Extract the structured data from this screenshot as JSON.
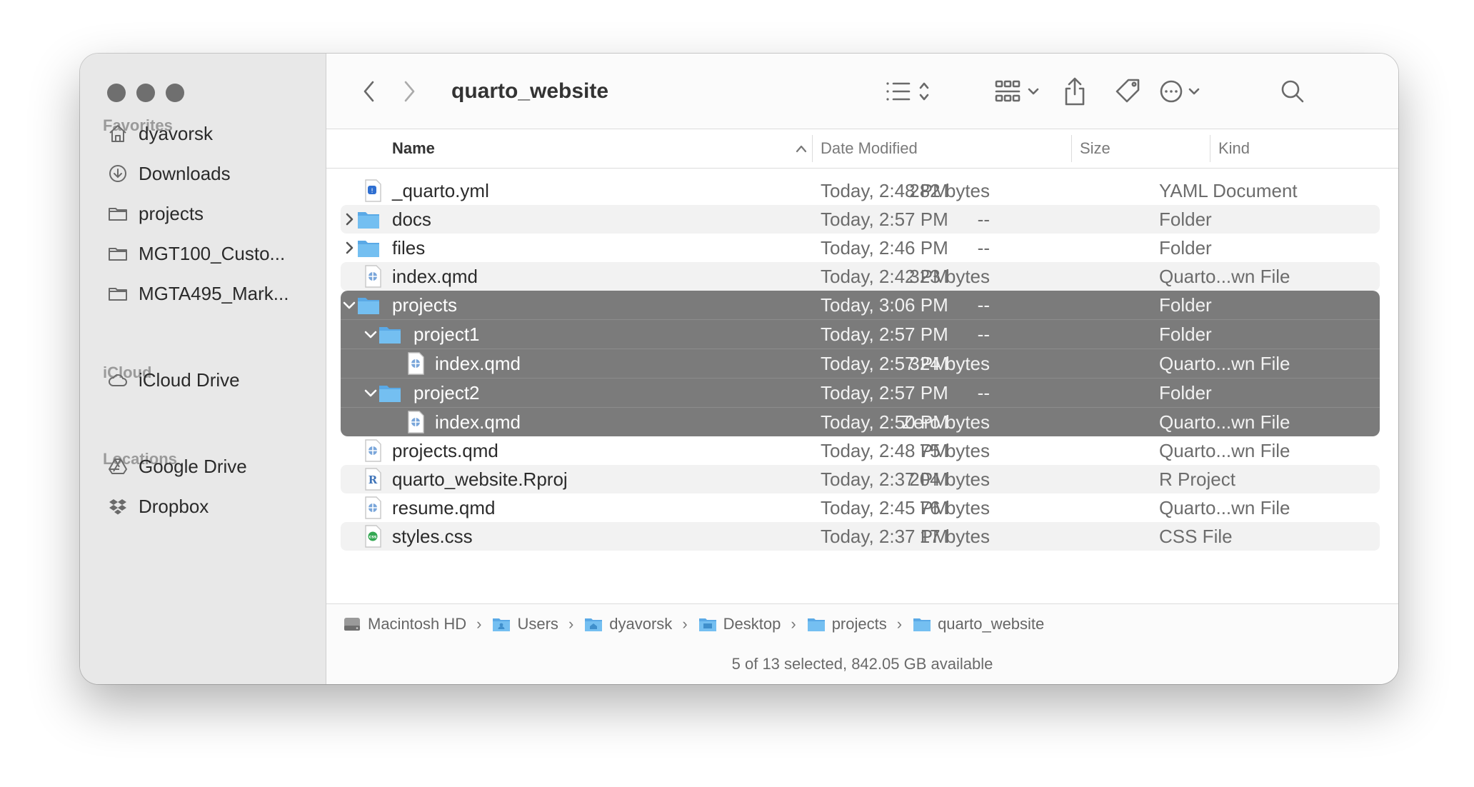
{
  "window": {
    "title": "quarto_website"
  },
  "sidebar": {
    "favorites_label": "Favorites",
    "favorites": [
      {
        "label": "dyavorsk",
        "icon": "home-icon"
      },
      {
        "label": "Downloads",
        "icon": "download-icon"
      },
      {
        "label": "projects",
        "icon": "folder-icon"
      },
      {
        "label": "MGT100_Custo...",
        "icon": "folder-icon"
      },
      {
        "label": "MGTA495_Mark...",
        "icon": "folder-icon"
      }
    ],
    "icloud_label": "iCloud",
    "icloud": [
      {
        "label": "iCloud Drive",
        "icon": "cloud-icon"
      }
    ],
    "locations_label": "Locations",
    "locations": [
      {
        "label": "Google Drive",
        "icon": "google-drive-icon"
      },
      {
        "label": "Dropbox",
        "icon": "dropbox-icon"
      }
    ]
  },
  "table": {
    "columns": {
      "name": "Name",
      "date": "Date Modified",
      "size": "Size",
      "kind": "Kind"
    },
    "rows": [
      {
        "name": "_quarto.yml",
        "date": "Today, 2:48 PM",
        "size": "282 bytes",
        "kind": "YAML Document",
        "icon": "yaml-file-icon"
      },
      {
        "name": "docs",
        "date": "Today, 2:57 PM",
        "size": "--",
        "kind": "Folder",
        "icon": "folder-icon"
      },
      {
        "name": "files",
        "date": "Today, 2:46 PM",
        "size": "--",
        "kind": "Folder",
        "icon": "folder-icon"
      },
      {
        "name": "index.qmd",
        "date": "Today, 2:42 PM",
        "size": "323 bytes",
        "kind": "Quarto...wn File",
        "icon": "quarto-file-icon"
      },
      {
        "name": "projects",
        "date": "Today, 3:06 PM",
        "size": "--",
        "kind": "Folder",
        "icon": "folder-icon"
      },
      {
        "name": "project1",
        "date": "Today, 2:57 PM",
        "size": "--",
        "kind": "Folder",
        "icon": "folder-icon"
      },
      {
        "name": "index.qmd",
        "date": "Today, 2:57 PM",
        "size": "324 bytes",
        "kind": "Quarto...wn File",
        "icon": "quarto-file-icon"
      },
      {
        "name": "project2",
        "date": "Today, 2:57 PM",
        "size": "--",
        "kind": "Folder",
        "icon": "folder-icon"
      },
      {
        "name": "index.qmd",
        "date": "Today, 2:50 PM",
        "size": "Zero bytes",
        "kind": "Quarto...wn File",
        "icon": "quarto-file-icon"
      },
      {
        "name": "projects.qmd",
        "date": "Today, 2:48 PM",
        "size": "75 bytes",
        "kind": "Quarto...wn File",
        "icon": "quarto-file-icon"
      },
      {
        "name": "quarto_website.Rproj",
        "date": "Today, 2:37 PM",
        "size": "204 bytes",
        "kind": "R Project",
        "icon": "r-project-icon"
      },
      {
        "name": "resume.qmd",
        "date": "Today, 2:45 PM",
        "size": "76 bytes",
        "kind": "Quarto...wn File",
        "icon": "quarto-file-icon"
      },
      {
        "name": "styles.css",
        "date": "Today, 2:37 PM",
        "size": "17 bytes",
        "kind": "CSS File",
        "icon": "css-file-icon"
      }
    ]
  },
  "pathbar": [
    {
      "label": "Macintosh HD",
      "icon": "hard-drive-icon"
    },
    {
      "label": "Users",
      "icon": "folder-icon"
    },
    {
      "label": "dyavorsk",
      "icon": "home-folder-icon"
    },
    {
      "label": "Desktop",
      "icon": "desktop-folder-icon"
    },
    {
      "label": "projects",
      "icon": "folder-icon"
    },
    {
      "label": "quarto_website",
      "icon": "folder-icon"
    }
  ],
  "status": "5 of 13 selected, 842.05 GB available",
  "colors": {
    "selection": "#7b7b7b",
    "folder_blue": "#6cb8ee",
    "sidebar_bg": "#e8e8e8"
  }
}
